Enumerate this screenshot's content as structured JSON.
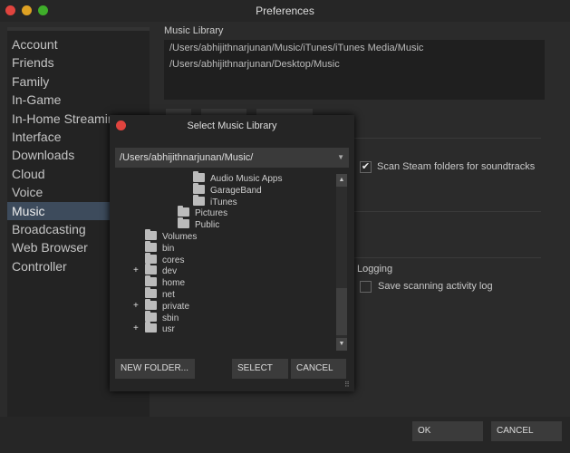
{
  "window": {
    "title": "Preferences",
    "lights": [
      "#e0443e",
      "#dea123",
      "#3fae2a"
    ]
  },
  "sidebar": {
    "items": [
      {
        "label": "Account"
      },
      {
        "label": "Friends"
      },
      {
        "label": "Family"
      },
      {
        "label": "In-Game"
      },
      {
        "label": "In-Home Streaming"
      },
      {
        "label": "Interface"
      },
      {
        "label": "Downloads"
      },
      {
        "label": "Cloud"
      },
      {
        "label": "Voice"
      },
      {
        "label": "Music",
        "selected": true
      },
      {
        "label": "Broadcasting"
      },
      {
        "label": "Web Browser"
      },
      {
        "label": "Controller"
      }
    ]
  },
  "main": {
    "library_label": "Music Library",
    "library_paths": [
      "/Users/abhijithnarjunan/Music/iTunes/iTunes Media/Music",
      "/Users/abhijithnarjunan/Desktop/Music"
    ],
    "scan_steam_label": "Scan Steam folders for soundtracks",
    "scan_steam_checked": true,
    "logging_label": "Logging",
    "save_log_label": "Save scanning activity log",
    "save_log_checked": false
  },
  "footer": {
    "ok": "OK",
    "cancel": "CANCEL"
  },
  "dialog": {
    "title": "Select Music Library",
    "path": "/Users/abhijithnarjunan/Music/",
    "tree": [
      {
        "name": "Audio Music Apps",
        "level": 2
      },
      {
        "name": "GarageBand",
        "level": 2
      },
      {
        "name": "iTunes",
        "level": 2
      },
      {
        "name": "Pictures",
        "level": 1
      },
      {
        "name": "Public",
        "level": 1
      },
      {
        "name": "Volumes",
        "level": 0
      },
      {
        "name": "bin",
        "level": 0
      },
      {
        "name": "cores",
        "level": 0
      },
      {
        "name": "dev",
        "level": 0,
        "expandable": true
      },
      {
        "name": "home",
        "level": 0
      },
      {
        "name": "net",
        "level": 0
      },
      {
        "name": "private",
        "level": 0,
        "expandable": true
      },
      {
        "name": "sbin",
        "level": 0
      },
      {
        "name": "usr",
        "level": 0,
        "expandable": true
      }
    ],
    "new_folder": "NEW FOLDER...",
    "select": "SELECT",
    "cancel": "CANCEL"
  }
}
